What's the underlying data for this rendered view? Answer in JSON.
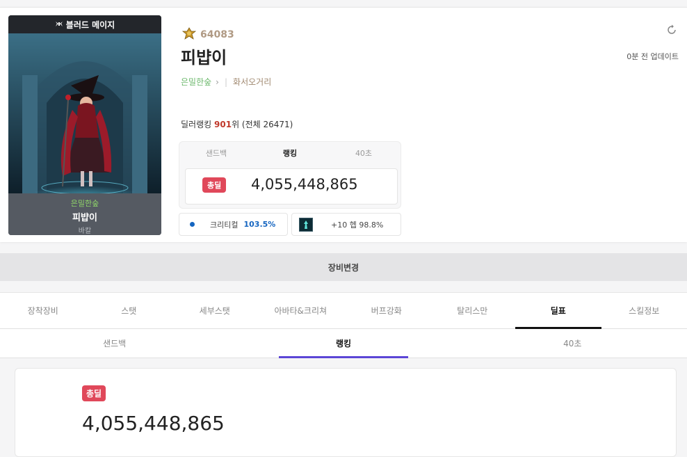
{
  "character": {
    "job": "블러드 메이지",
    "name": "피뱝이",
    "guild": "은밀한숲",
    "server_footer": "바칼",
    "adventure_level": "64083",
    "server": "화서오거리"
  },
  "update": {
    "text": "0분 전 업데이트"
  },
  "ranking": {
    "prefix": "딜러랭킹",
    "rank": "901",
    "suffix": "위 (전체 26471)"
  },
  "mini_tabs": [
    "샌드백",
    "랭킹",
    "40초"
  ],
  "total": {
    "badge": "총딜",
    "value": "4,055,448,865"
  },
  "stats": {
    "crit_label": "크리티컬",
    "crit_value": "103.5%",
    "weapon_text": "+10 헵 98.8%"
  },
  "equip_change_label": "장비변경",
  "main_tabs": [
    "장착장비",
    "스탯",
    "세부스탯",
    "아바타&크리쳐",
    "버프강화",
    "탈리스만",
    "딜표",
    "스킬정보"
  ],
  "sub_tabs": [
    "샌드백",
    "랭킹",
    "40초"
  ],
  "colors": {
    "badge_red": "#e0485a",
    "rank_red": "#c0392b",
    "crit_blue": "#1565c0",
    "active_sub_tab": "#5b45d6",
    "guild_green": "#6bb86b"
  },
  "icons": {
    "adventure": "medal-icon",
    "refresh": "refresh-icon",
    "job": "wing-icon",
    "weapon": "weapon-icon"
  }
}
